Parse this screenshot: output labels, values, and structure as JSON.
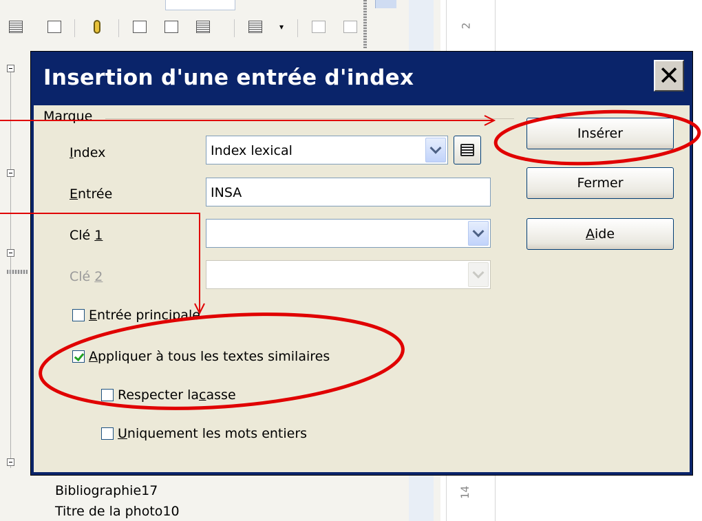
{
  "background": {
    "ruler_marks": [
      "2",
      "14"
    ],
    "tree_items": [
      "Bibliographie17",
      "Titre de la photo10"
    ]
  },
  "dialog": {
    "title": "Insertion d'une entrée d'index",
    "close_label": "✕",
    "group_label": "Marque",
    "index": {
      "label_first": "I",
      "label_rest": "ndex",
      "value": "Index lexical"
    },
    "entree": {
      "label_first": "E",
      "label_rest": "ntrée",
      "value": "INSA"
    },
    "cle1": {
      "label_prefix": "Clé ",
      "label_u": "1",
      "value": ""
    },
    "cle2": {
      "label_prefix": "Clé ",
      "label_u": "2",
      "value": ""
    },
    "checkboxes": {
      "entree_principale": {
        "first": "E",
        "rest": "ntrée principale",
        "checked": false
      },
      "appliquer": {
        "first": "A",
        "rest": "ppliquer à tous les textes similaires",
        "checked": true
      },
      "respecter": {
        "prefix": "Respecter la ",
        "u": "c",
        "rest": "asse",
        "checked": false
      },
      "uniquement": {
        "first": "U",
        "rest": "niquement les mots entiers",
        "checked": false
      }
    },
    "buttons": {
      "inserer": "Insérer",
      "fermer": "Fermer",
      "aide_first": "A",
      "aide_rest": "ide"
    }
  },
  "annotation_colors": {
    "red": "#e00000"
  }
}
